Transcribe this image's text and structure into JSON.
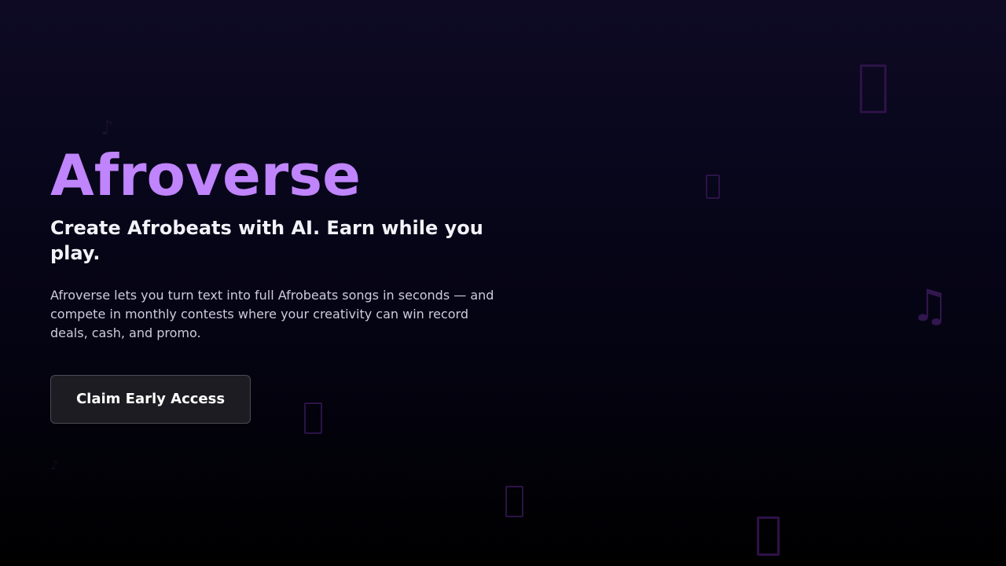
{
  "hero": {
    "title": "Afroverse",
    "tagline": "Create Afrobeats with AI. Earn while you play.",
    "description": "Afroverse lets you turn text into full Afrobeats songs in seconds — and compete in monthly contests where your creativity can win record deals, cash, and promo.",
    "cta_label": "Claim Early Access"
  },
  "decorations": {
    "note_glyph": "♫",
    "small_note_glyph": "♪"
  },
  "colors": {
    "accent": "#c084fc",
    "button_bg": "#1c1c22",
    "button_border": "#4b4b55",
    "background_top": "#0e0a24",
    "background_bottom": "#000000",
    "decor": "#3b1a5e"
  }
}
